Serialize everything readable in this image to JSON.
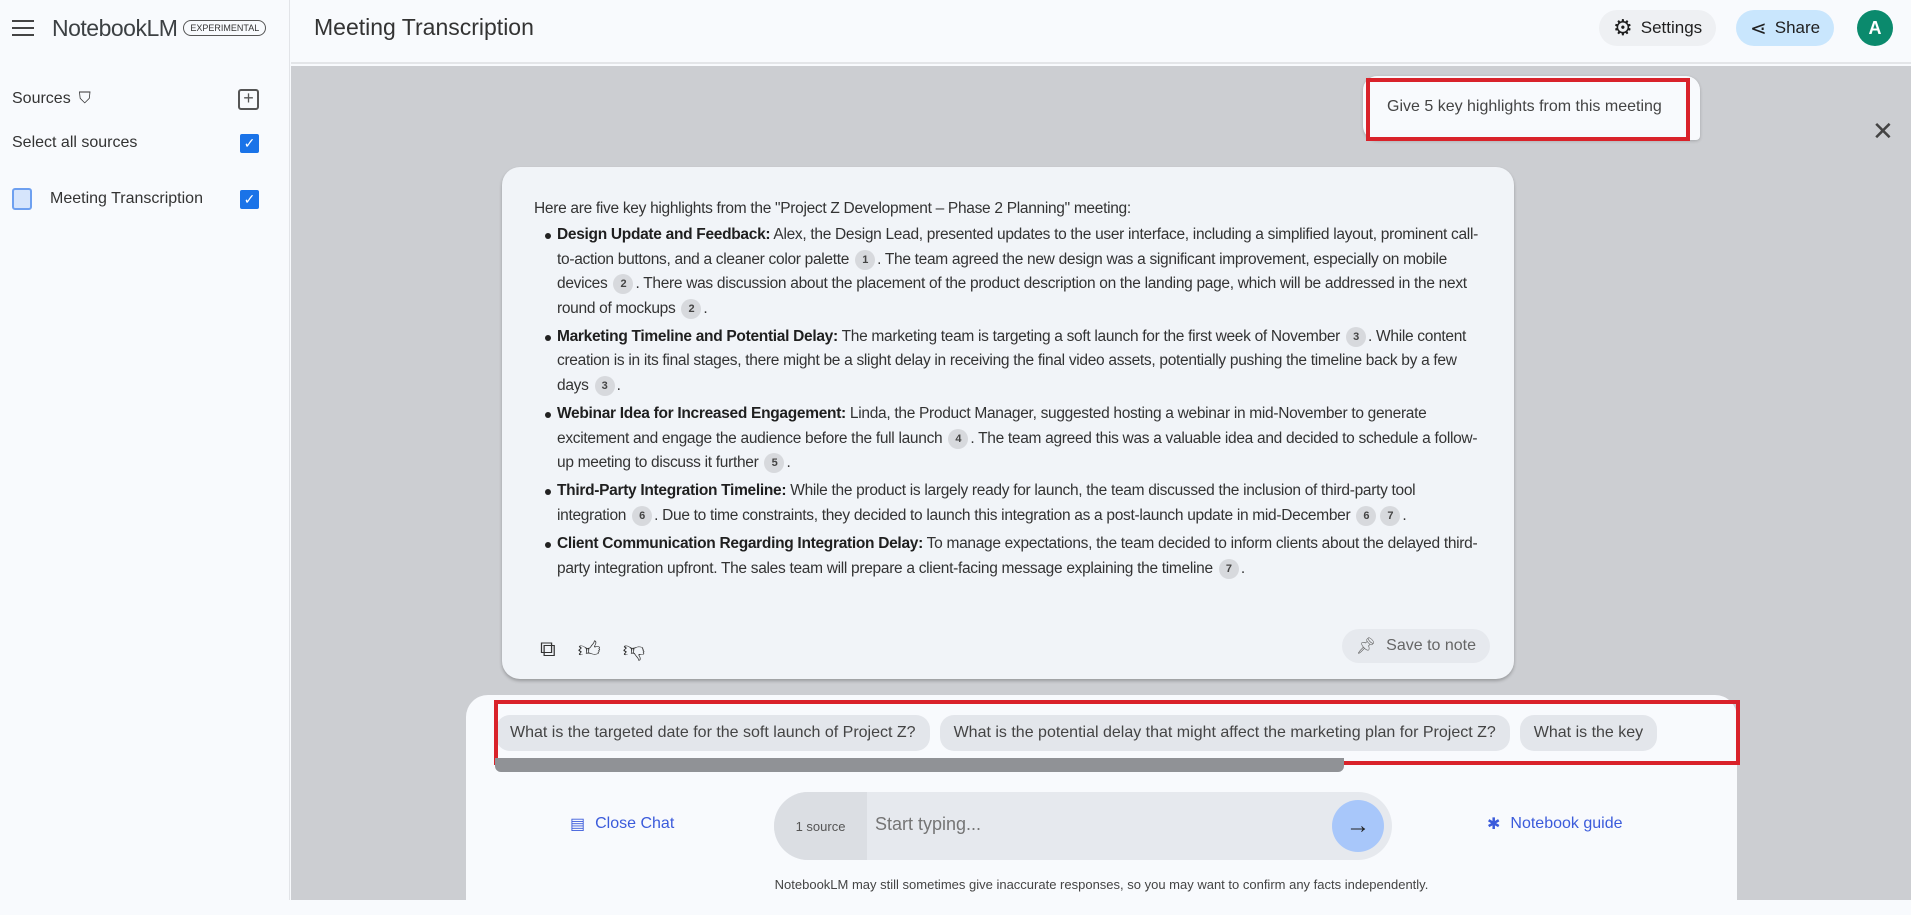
{
  "app": {
    "name": "NotebookLM",
    "badge": "EXPERIMENTAL"
  },
  "sidebar": {
    "sources_label": "Sources",
    "select_all_label": "Select all sources",
    "sources": [
      {
        "name": "Meeting Transcription",
        "checked": true
      }
    ]
  },
  "header": {
    "title": "Meeting Transcription",
    "settings_label": "Settings",
    "share_label": "Share",
    "avatar_initial": "A"
  },
  "chat": {
    "user_query": "Give 5 key highlights from this meeting",
    "response_intro": "Here are five key highlights from the \"Project Z Development – Phase 2 Planning\" meeting:",
    "items": [
      {
        "title": "Design Update and Feedback:",
        "parts": [
          {
            "t": " Alex, the Design Lead, presented updates to the user interface, including a simplified layout, prominent call-to-action buttons, and a cleaner color palette "
          },
          {
            "c": "1"
          },
          {
            "t": ". The team agreed the new design was a significant improvement, especially on mobile devices "
          },
          {
            "c": "2"
          },
          {
            "t": ". There was discussion about the placement of the product description on the landing page, which will be addressed in the next round of mockups "
          },
          {
            "c": "2"
          },
          {
            "t": "."
          }
        ]
      },
      {
        "title": "Marketing Timeline and Potential Delay:",
        "parts": [
          {
            "t": " The marketing team is targeting a soft launch for the first week of November "
          },
          {
            "c": "3"
          },
          {
            "t": ". While content creation is in its final stages, there might be a slight delay in receiving the final video assets, potentially pushing the timeline back by a few days "
          },
          {
            "c": "3"
          },
          {
            "t": "."
          }
        ]
      },
      {
        "title": "Webinar Idea for Increased Engagement:",
        "parts": [
          {
            "t": " Linda, the Product Manager, suggested hosting a webinar in mid-November to generate excitement and engage the audience before the full launch "
          },
          {
            "c": "4"
          },
          {
            "t": ". The team agreed this was a valuable idea and decided to schedule a follow-up meeting to discuss it further "
          },
          {
            "c": "5"
          },
          {
            "t": "."
          }
        ]
      },
      {
        "title": "Third-Party Integration Timeline:",
        "parts": [
          {
            "t": " While the product is largely ready for launch, the team discussed the inclusion of third-party tool integration "
          },
          {
            "c": "6"
          },
          {
            "t": ". Due to time constraints, they decided to launch this integration as a post-launch update in mid-December "
          },
          {
            "c": "6"
          },
          {
            "c": "7"
          },
          {
            "t": "."
          }
        ]
      },
      {
        "title": "Client Communication Regarding Integration Delay:",
        "parts": [
          {
            "t": " To manage expectations, the team decided to inform clients about the delayed third-party integration upfront. The sales team will prepare a client-facing message explaining the timeline "
          },
          {
            "c": "7"
          },
          {
            "t": "."
          }
        ]
      }
    ],
    "save_to_note_label": "Save to note",
    "suggestions": [
      "What is the targeted date for the soft launch of Project Z?",
      "What is the potential delay that might affect the marketing plan for Project Z?",
      "What is the key"
    ]
  },
  "composer": {
    "source_count": "1 source",
    "placeholder": "Start typing...",
    "close_chat_label": "Close Chat",
    "notebook_guide_label": "Notebook guide",
    "disclaimer": "NotebookLM may still sometimes give inaccurate responses, so you may want to confirm any facts independently."
  },
  "colors": {
    "accent": "#1a73e8",
    "highlight_box": "#d9222a",
    "avatar": "#0b8a6d"
  }
}
